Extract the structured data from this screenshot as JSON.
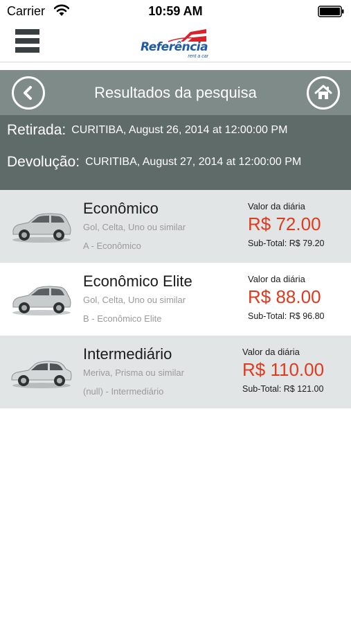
{
  "status_bar": {
    "carrier": "Carrier",
    "time": "10:59 AM"
  },
  "app_header": {
    "logo_text": "Referência",
    "logo_subtext": "rent a car",
    "brand_colors": {
      "blue": "#1d5aa8",
      "red": "#d8232a"
    }
  },
  "title_bar": {
    "title": "Resultados da pesquisa",
    "back_icon": "chevron-left-icon",
    "home_icon": "home-icon"
  },
  "search_info": {
    "pickup_label": "Retirada:",
    "pickup_value": "CURITIBA, August 26, 2014 at 12:00:00 PM",
    "return_label": "Devolução:",
    "return_value": "CURITIBA, August 27, 2014 at 12:00:00 PM"
  },
  "results": [
    {
      "name": "Econômico",
      "models": "Gol, Celta, Uno ou similar",
      "group": "A - Econômico",
      "daily_label": "Valor da diária",
      "daily_price": "R$ 72.00",
      "subtotal": "Sub-Total: R$ 79.20",
      "car_color": "#c9cccd"
    },
    {
      "name": "Econômico Elite",
      "models": "Gol, Celta, Uno ou similar",
      "group": "B - Econômico Elite",
      "daily_label": "Valor da diária",
      "daily_price": "R$ 88.00",
      "subtotal": "Sub-Total: R$ 96.80",
      "car_color": "#c9cccd"
    },
    {
      "name": "Intermediário",
      "models": "Meriva, Prisma ou similar",
      "group": "(null) - Intermediário",
      "daily_label": "Valor da diária",
      "daily_price": "R$ 110.00",
      "subtotal": "Sub-Total: R$ 121.00",
      "car_color": "#d4d8d9"
    }
  ],
  "colors": {
    "title_bar_bg": "#7e8b89",
    "info_panel_bg": "#5f6b69",
    "row_shaded_bg": "#e2e5e5",
    "price_red": "#e03a1e"
  }
}
